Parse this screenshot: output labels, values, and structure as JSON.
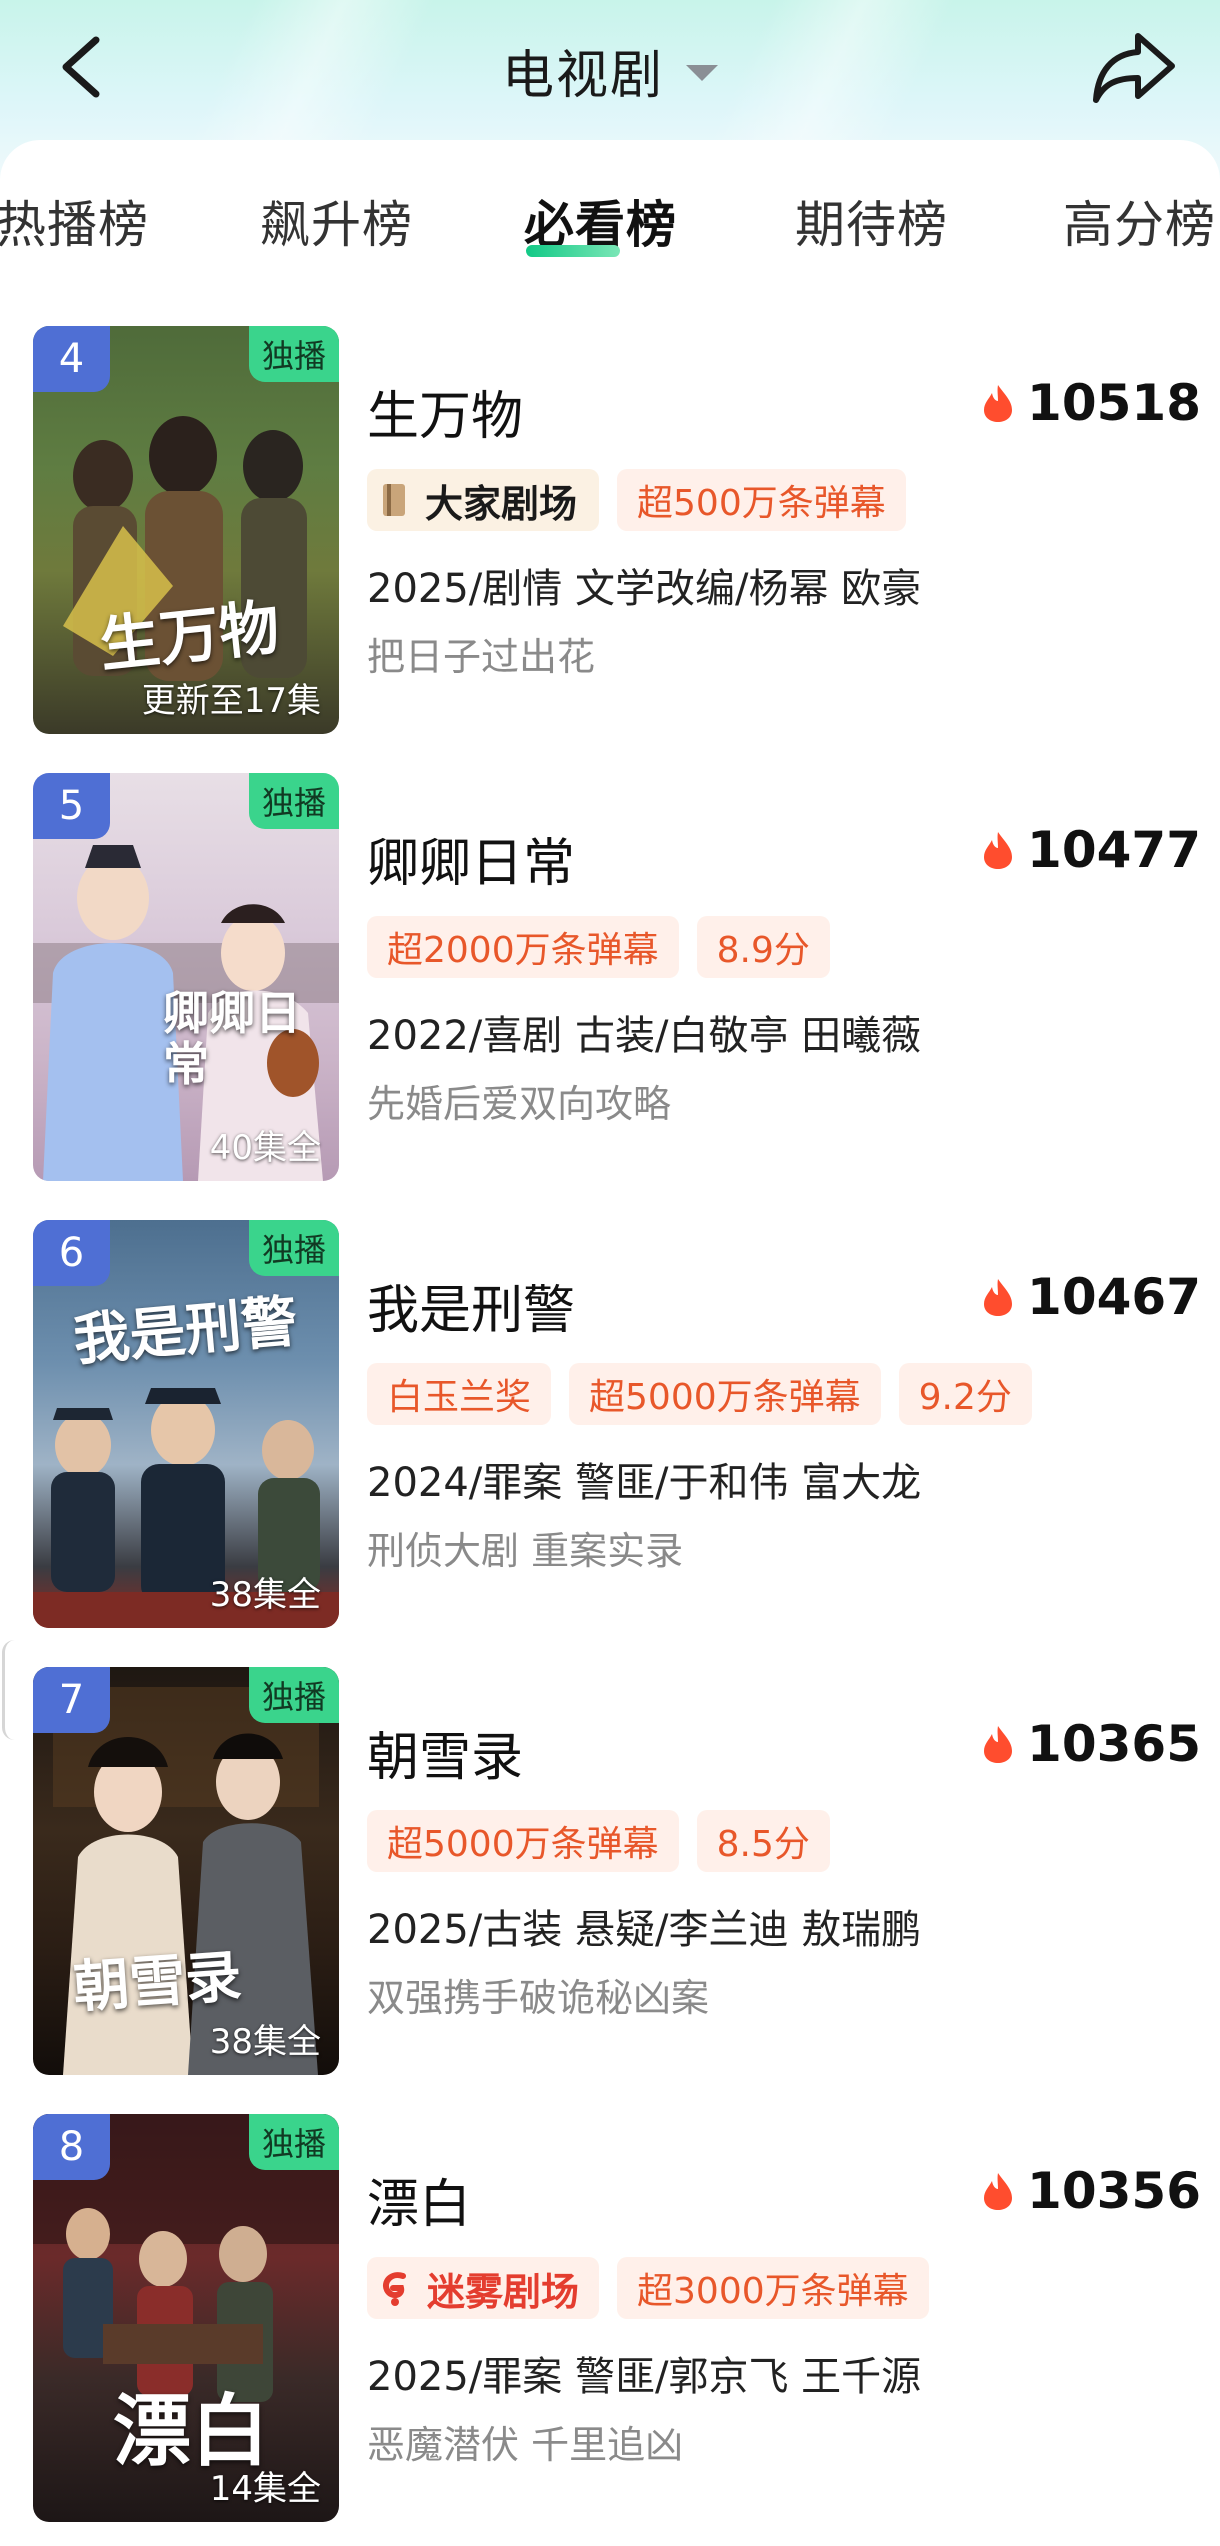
{
  "header": {
    "title": "电视剧",
    "back_icon": "chevron-left-icon",
    "share_icon": "share-icon"
  },
  "tabs": [
    {
      "label": "热播榜",
      "active": false
    },
    {
      "label": "飙升榜",
      "active": false
    },
    {
      "label": "必看榜",
      "active": true
    },
    {
      "label": "期待榜",
      "active": false
    },
    {
      "label": "高分榜",
      "active": false
    }
  ],
  "colors": {
    "accent_green": "#2fcf86",
    "rank_badge": "#4f6fd4",
    "tag_bg": "#fff0ea",
    "tag_text": "#e8572a",
    "flame": "#ff4d2e"
  },
  "items": [
    {
      "rank": "4",
      "exclusive": "独播",
      "episodes": "更新至17集",
      "poster_title": "生万物",
      "name": "生万物",
      "heat": "10518",
      "tags": [
        {
          "kind": "brand",
          "label": "大家剧场"
        },
        {
          "kind": "text",
          "label": "超500万条弹幕"
        }
      ],
      "meta": "2025/剧情 文学改编/杨幂 欧豪",
      "slogan": "把日子过出花"
    },
    {
      "rank": "5",
      "exclusive": "独播",
      "episodes": "40集全",
      "poster_title": "卿卿日常",
      "name": "卿卿日常",
      "heat": "10477",
      "tags": [
        {
          "kind": "text",
          "label": "超2000万条弹幕"
        },
        {
          "kind": "text",
          "label": "8.9分"
        }
      ],
      "meta": "2022/喜剧 古装/白敬亭 田曦薇",
      "slogan": "先婚后爱双向攻略"
    },
    {
      "rank": "6",
      "exclusive": "独播",
      "episodes": "38集全",
      "poster_title": "我是刑警",
      "name": "我是刑警",
      "heat": "10467",
      "tags": [
        {
          "kind": "text",
          "label": "白玉兰奖"
        },
        {
          "kind": "text",
          "label": "超5000万条弹幕"
        },
        {
          "kind": "text",
          "label": "9.2分"
        }
      ],
      "meta": "2024/罪案 警匪/于和伟 富大龙",
      "slogan": "刑侦大剧 重案实录"
    },
    {
      "rank": "7",
      "exclusive": "独播",
      "episodes": "38集全",
      "poster_title": "朝雪录",
      "name": "朝雪录",
      "heat": "10365",
      "tags": [
        {
          "kind": "text",
          "label": "超5000万条弹幕"
        },
        {
          "kind": "text",
          "label": "8.5分"
        }
      ],
      "meta": "2025/古装 悬疑/李兰迪 敖瑞鹏",
      "slogan": "双强携手破诡秘凶案"
    },
    {
      "rank": "8",
      "exclusive": "独播",
      "episodes": "14集全",
      "poster_title": "漂白",
      "name": "漂白",
      "heat": "10356",
      "tags": [
        {
          "kind": "brand",
          "label": "迷雾剧场"
        },
        {
          "kind": "text",
          "label": "超3000万条弹幕"
        }
      ],
      "meta": "2025/罪案 警匪/郭京飞 王千源",
      "slogan": "恶魔潜伏 千里追凶"
    }
  ]
}
